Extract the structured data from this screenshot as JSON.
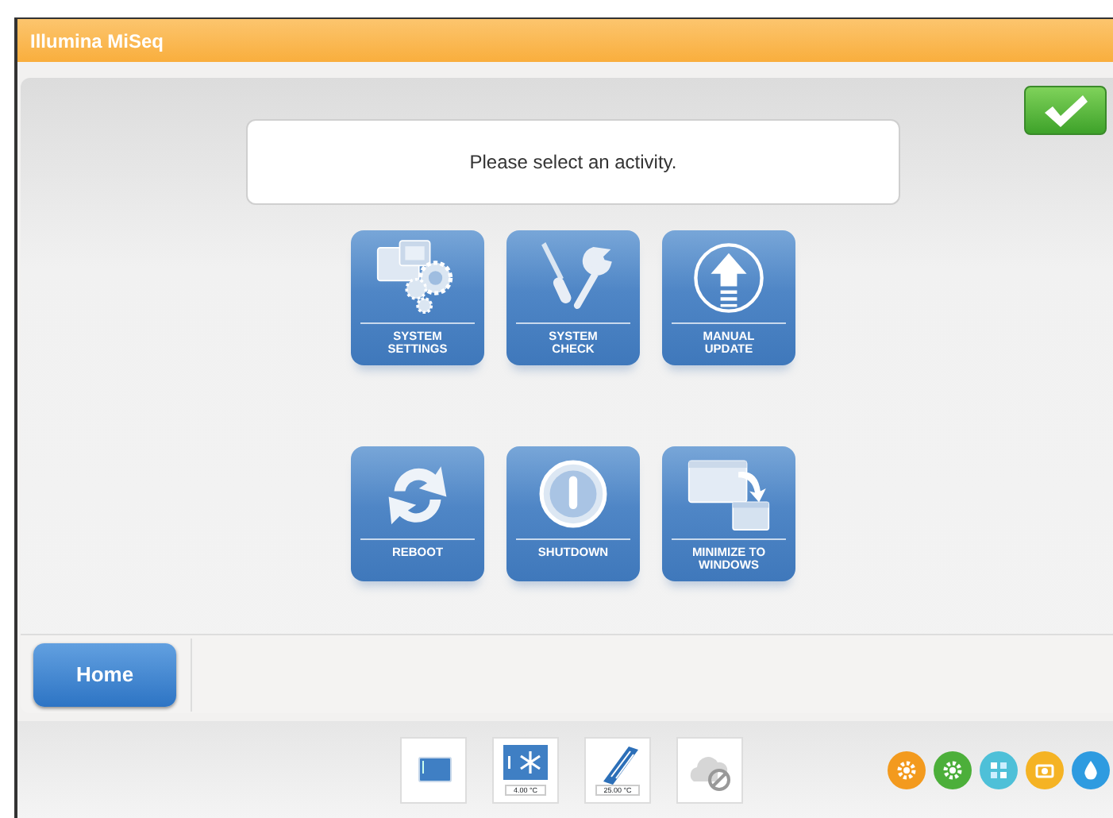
{
  "window": {
    "title": "Illumina MiSeq"
  },
  "confirm_button": {
    "kind": "check"
  },
  "message": "Please select an activity.",
  "tiles": [
    {
      "label": "SYSTEM SETTINGS",
      "kind": "settings"
    },
    {
      "label": "SYSTEM CHECK",
      "kind": "check"
    },
    {
      "label": "MANUAL UPDATE",
      "kind": "update"
    },
    {
      "label": "REBOOT",
      "kind": "reboot"
    },
    {
      "label": "SHUTDOWN",
      "kind": "shutdown"
    },
    {
      "label": "MINIMIZE TO WINDOWS",
      "kind": "minimize"
    }
  ],
  "home_button": "Home",
  "status_bar": {
    "instruments": [
      {
        "kind": "screen"
      },
      {
        "kind": "chiller",
        "reading": "4.00 °C"
      },
      {
        "kind": "flowcell",
        "reading": "25.00 °C"
      },
      {
        "kind": "network"
      }
    ],
    "indicators": [
      {
        "kind": "gear",
        "color": "#f39a1e"
      },
      {
        "kind": "gear",
        "color": "#4caf3a"
      },
      {
        "kind": "grid",
        "color": "#4ec0d8"
      },
      {
        "kind": "camera",
        "color": "#f5b324"
      },
      {
        "kind": "drop",
        "color": "#2e9be0"
      }
    ]
  }
}
